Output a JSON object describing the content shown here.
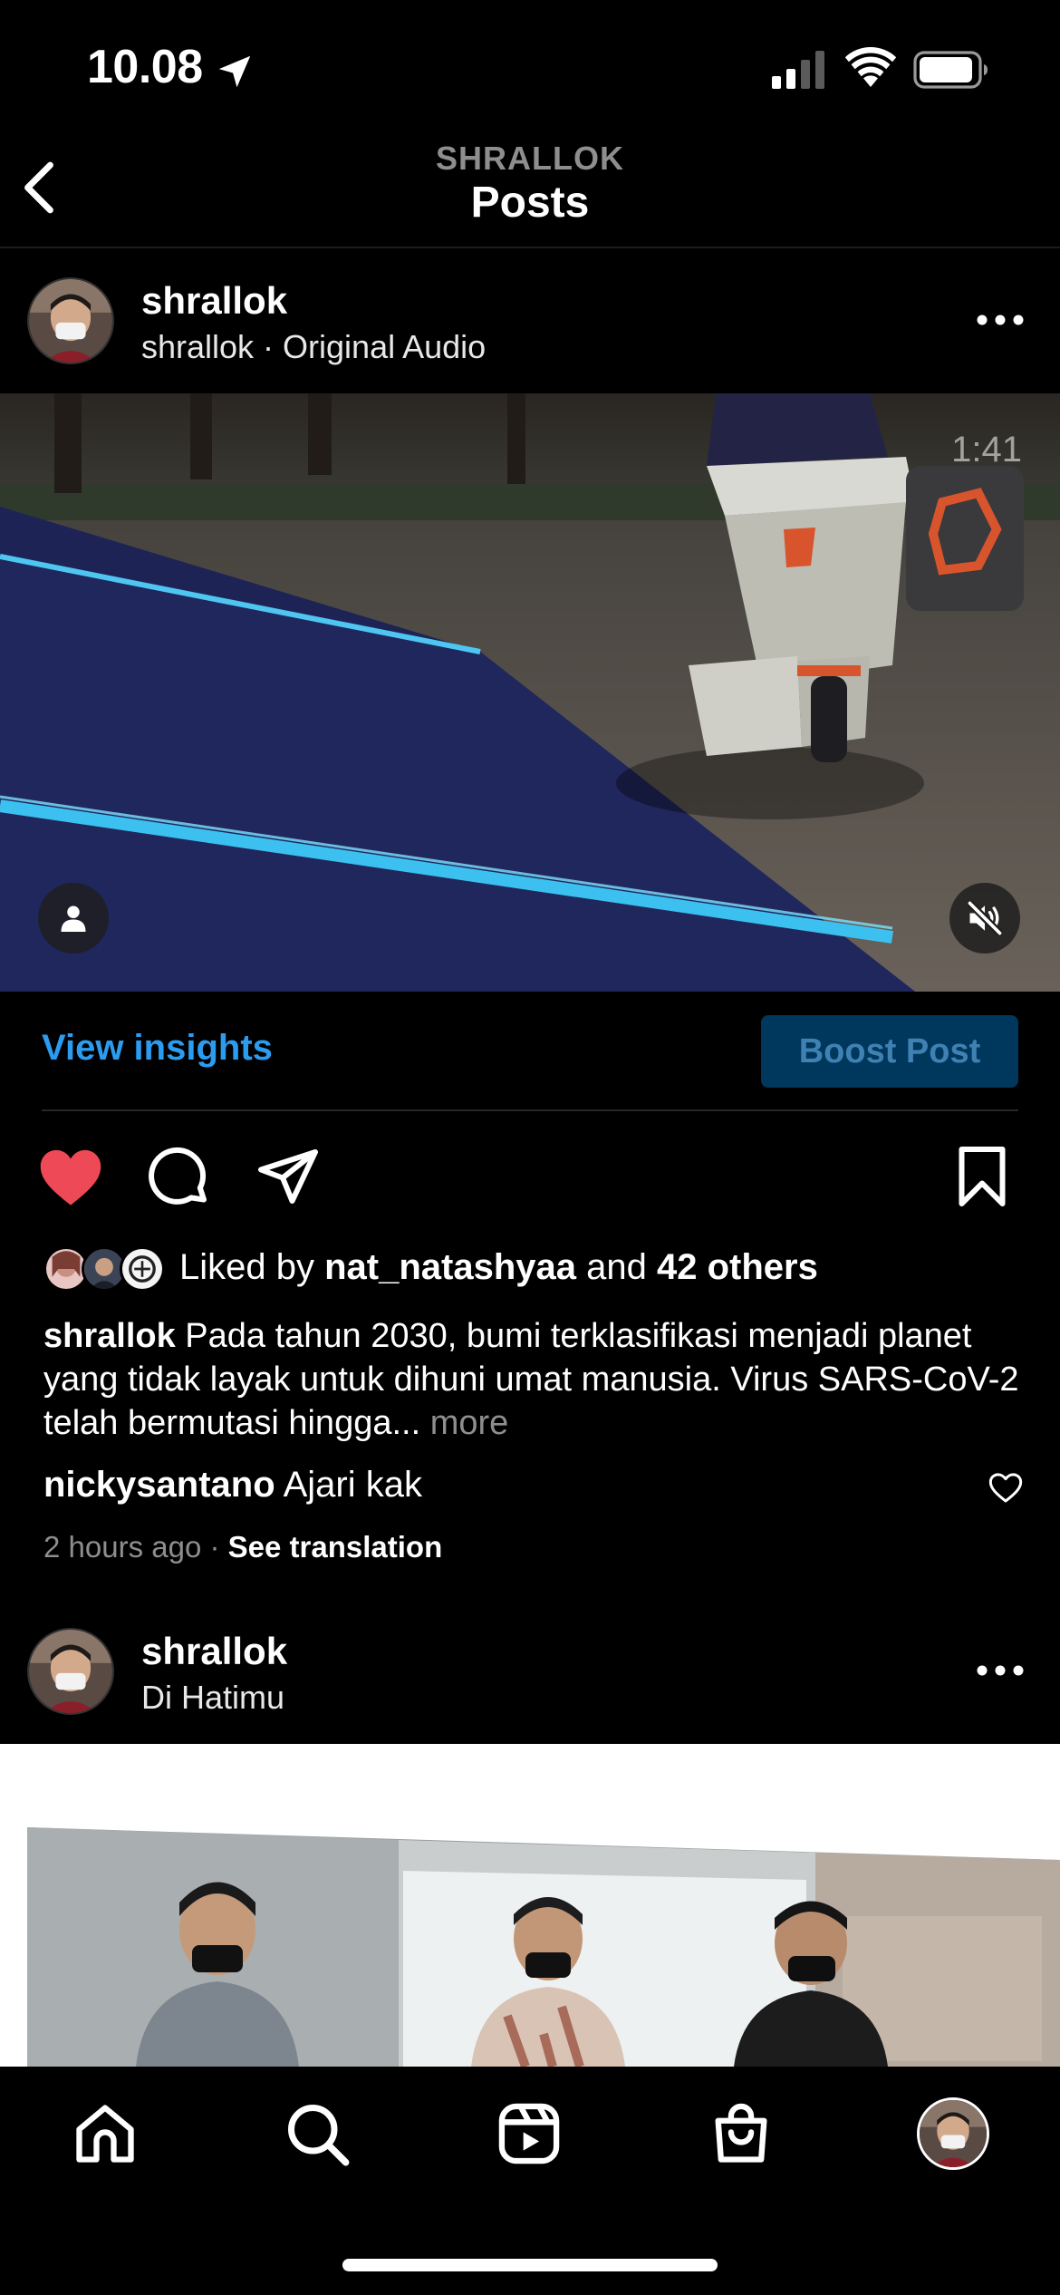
{
  "status_bar": {
    "time": "10.08",
    "icons": [
      "location-arrow-icon",
      "signal-icon",
      "wifi-icon",
      "battery-icon"
    ]
  },
  "header": {
    "kicker": "SHRALLOK",
    "title": "Posts",
    "back_icon": "chevron-left-icon"
  },
  "post1": {
    "username": "shrallok",
    "subtitle": "shrallok · Original Audio",
    "video_duration": "1:41",
    "insights_label": "View insights",
    "boost_label": "Boost Post",
    "liked": true,
    "likes": {
      "prefix": "Liked by ",
      "user": "nat_natashyaa",
      "middle": " and ",
      "others": "42 others"
    },
    "caption": {
      "username": "shrallok",
      "text": " Pada tahun 2030, bumi terklasifikasi menjadi planet yang tidak layak untuk dihuni umat manusia. Virus SARS-CoV-2 telah bermutasi hingga...",
      "more": "more"
    },
    "comment": {
      "username": "nickysantano",
      "text": " Ajari kak"
    },
    "time_ago": "2 hours ago",
    "separator": "·",
    "see_translation": "See translation"
  },
  "post2": {
    "username": "shrallok",
    "subtitle": "Di Hatimu"
  },
  "bottom_nav": {
    "items": [
      "home-icon",
      "search-icon",
      "reels-icon",
      "shop-icon",
      "profile-avatar"
    ]
  },
  "colors": {
    "accent_blue": "#2b9cf0",
    "like_red": "#ed4956",
    "boost_bg": "#00375c",
    "boost_text": "#3f81b3",
    "muted_text": "#8e8e8e"
  }
}
